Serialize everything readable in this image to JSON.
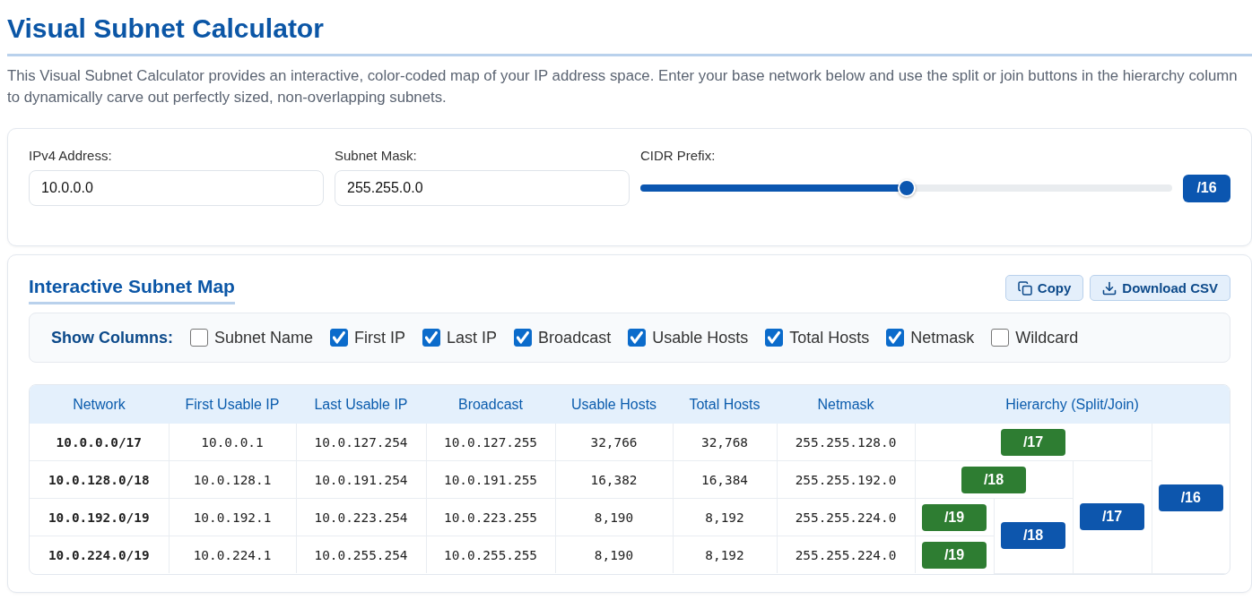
{
  "title": "Visual Subnet Calculator",
  "description": "This Visual Subnet Calculator provides an interactive, color-coded map of your IP address space. Enter your base network below and use the split or join buttons in the hierarchy column to dynamically carve out perfectly sized, non-overlapping subnets.",
  "inputs": {
    "ipv4": {
      "label": "IPv4 Address:",
      "value": "10.0.0.0"
    },
    "mask": {
      "label": "Subnet Mask:",
      "value": "255.255.0.0"
    },
    "cidr": {
      "label": "CIDR Prefix:",
      "level": 0.5,
      "reading": "/16"
    }
  },
  "subnet_map": {
    "heading": "Interactive Subnet Map",
    "buttons": [
      {
        "label": "Copy",
        "kind": "copy"
      },
      {
        "label": "Download CSV",
        "kind": "download"
      }
    ],
    "show_columns": {
      "label": "Show Columns:",
      "options": [
        {
          "label": "Subnet Name",
          "checked": false
        },
        {
          "label": "First IP",
          "checked": true
        },
        {
          "label": "Last IP",
          "checked": true
        },
        {
          "label": "Broadcast",
          "checked": true
        },
        {
          "label": "Usable Hosts",
          "checked": true
        },
        {
          "label": "Total Hosts",
          "checked": true
        },
        {
          "label": "Netmask",
          "checked": true
        },
        {
          "label": "Wildcard",
          "checked": false
        }
      ]
    },
    "table": {
      "columns": [
        "Network",
        "First Usable IP",
        "Last Usable IP",
        "Broadcast",
        "Usable Hosts",
        "Total Hosts",
        "Netmask",
        "Hierarchy (Split/Join)"
      ],
      "rows": [
        [
          "10.0.0.0/17",
          "10.0.0.1",
          "10.0.127.254",
          "10.0.127.255",
          "32,766",
          "32,768",
          "255.255.128.0"
        ],
        [
          "10.0.128.0/18",
          "10.0.128.1",
          "10.0.191.254",
          "10.0.191.255",
          "16,382",
          "16,384",
          "255.255.192.0"
        ],
        [
          "10.0.192.0/19",
          "10.0.192.1",
          "10.0.223.254",
          "10.0.223.255",
          "8,190",
          "8,192",
          "255.255.224.0"
        ],
        [
          "10.0.224.0/19",
          "10.0.224.1",
          "10.0.255.254",
          "10.0.255.255",
          "8,190",
          "8,192",
          "255.255.224.0"
        ]
      ],
      "hierarchy": {
        "label": "/16",
        "kind": "join",
        "children": [
          {
            "label": "/17",
            "kind": "split"
          },
          {
            "label": "/17",
            "kind": "join",
            "children": [
              {
                "label": "/18",
                "kind": "split"
              },
              {
                "label": "/18",
                "kind": "join",
                "children": [
                  {
                    "label": "/19",
                    "kind": "split"
                  },
                  {
                    "label": "/19",
                    "kind": "split"
                  }
                ]
              }
            ]
          }
        ]
      }
    }
  }
}
